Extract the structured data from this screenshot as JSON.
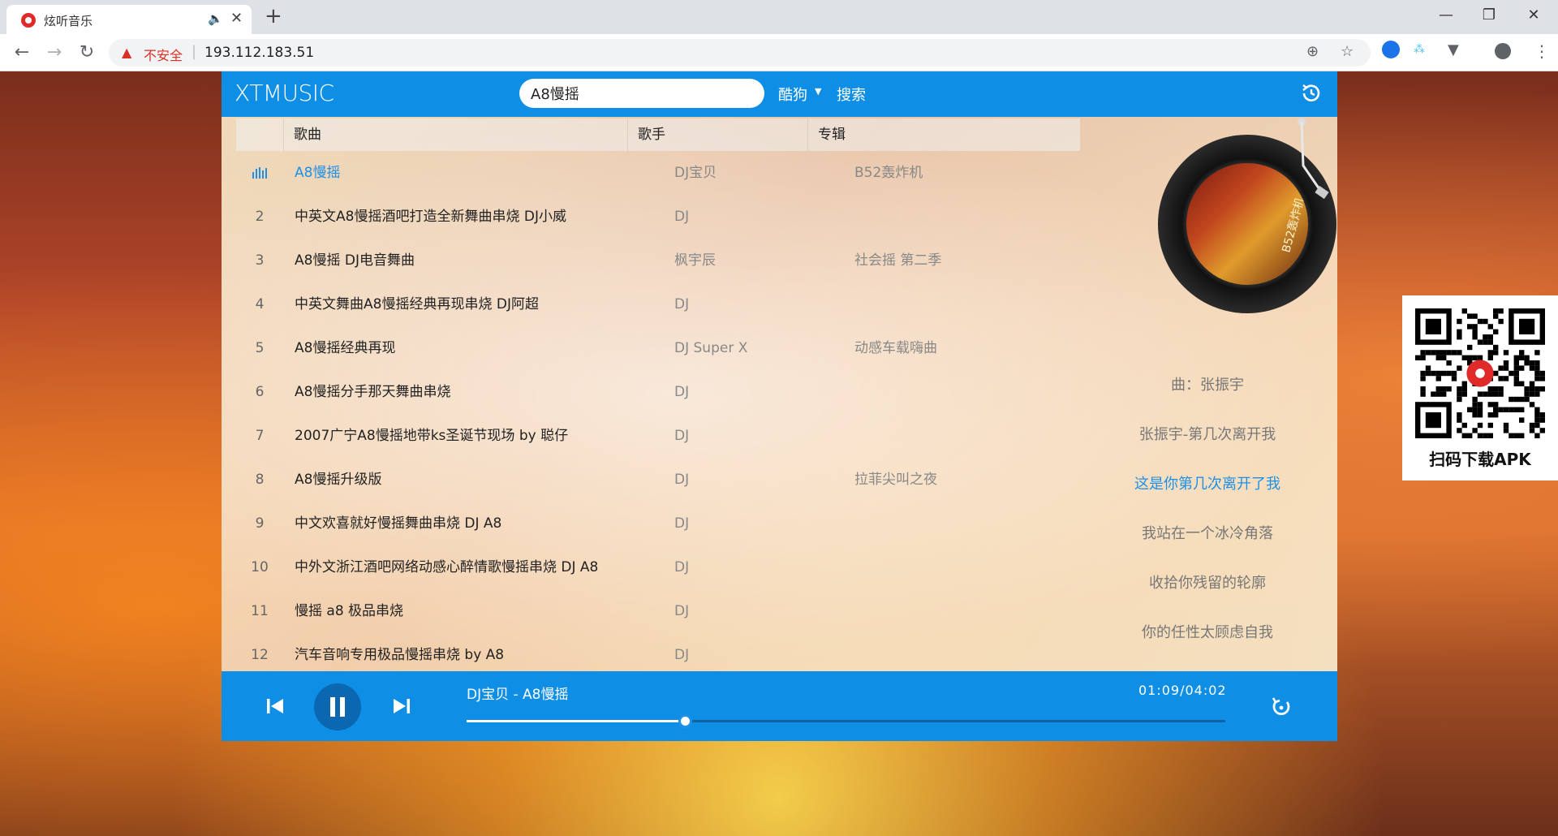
{
  "browser": {
    "tab_title": "炫听音乐",
    "insecure_label": "不安全",
    "url": "193.112.183.51",
    "accent": "#d93025"
  },
  "app": {
    "logo": "XTMUSIC",
    "search_value": "A8慢摇",
    "source": "酷狗",
    "search_label": "搜索",
    "accent": "#0f8ee6"
  },
  "list": {
    "headers": {
      "song": "歌曲",
      "singer": "歌手",
      "album": "专辑"
    },
    "rows": [
      {
        "num": "",
        "song": "A8慢摇",
        "singer": "DJ宝贝",
        "album": "B52轰炸机",
        "playing": true
      },
      {
        "num": "2",
        "song": "中英文A8慢摇酒吧打造全新舞曲串烧 DJ小威",
        "singer": "DJ",
        "album": ""
      },
      {
        "num": "3",
        "song": "A8慢摇 DJ电音舞曲",
        "singer": "枫宇辰",
        "album": "社会摇 第二季"
      },
      {
        "num": "4",
        "song": "中英文舞曲A8慢摇经典再现串烧 DJ阿超",
        "singer": "DJ",
        "album": ""
      },
      {
        "num": "5",
        "song": "A8慢摇经典再现",
        "singer": "DJ Super X",
        "album": "动感车载嗨曲"
      },
      {
        "num": "6",
        "song": "A8慢摇分手那天舞曲串烧",
        "singer": "DJ",
        "album": ""
      },
      {
        "num": "7",
        "song": "2007广宁A8慢摇地带ks圣诞节现场 by 聪仔",
        "singer": "DJ",
        "album": ""
      },
      {
        "num": "8",
        "song": "A8慢摇升级版",
        "singer": "DJ",
        "album": "拉菲尖叫之夜"
      },
      {
        "num": "9",
        "song": "中文欢喜就好慢摇舞曲串烧 DJ A8",
        "singer": "DJ",
        "album": ""
      },
      {
        "num": "10",
        "song": "中外文浙江酒吧网络动感心醉情歌慢摇串烧 DJ A8",
        "singer": "DJ",
        "album": ""
      },
      {
        "num": "11",
        "song": "慢摇 a8 极品串烧",
        "singer": "DJ",
        "album": ""
      },
      {
        "num": "12",
        "song": "汽车音响专用极品慢摇串烧 by A8",
        "singer": "DJ",
        "album": ""
      }
    ]
  },
  "cover": {
    "text": "B52轰炸机"
  },
  "lyrics": [
    {
      "text": "曲：张振宇",
      "active": false
    },
    {
      "text": "张振宇-第几次离开我",
      "active": false
    },
    {
      "text": "这是你第几次离开了我",
      "active": true
    },
    {
      "text": "我站在一个冰冷角落",
      "active": false
    },
    {
      "text": "收拾你残留的轮廓",
      "active": false
    },
    {
      "text": "你的任性太顾虑自我",
      "active": false
    }
  ],
  "player": {
    "now_playing": "DJ宝贝 - A8慢摇",
    "time": "01:09/04:02",
    "progress": 0.288
  },
  "qr": {
    "label": "扫码下载APK"
  }
}
